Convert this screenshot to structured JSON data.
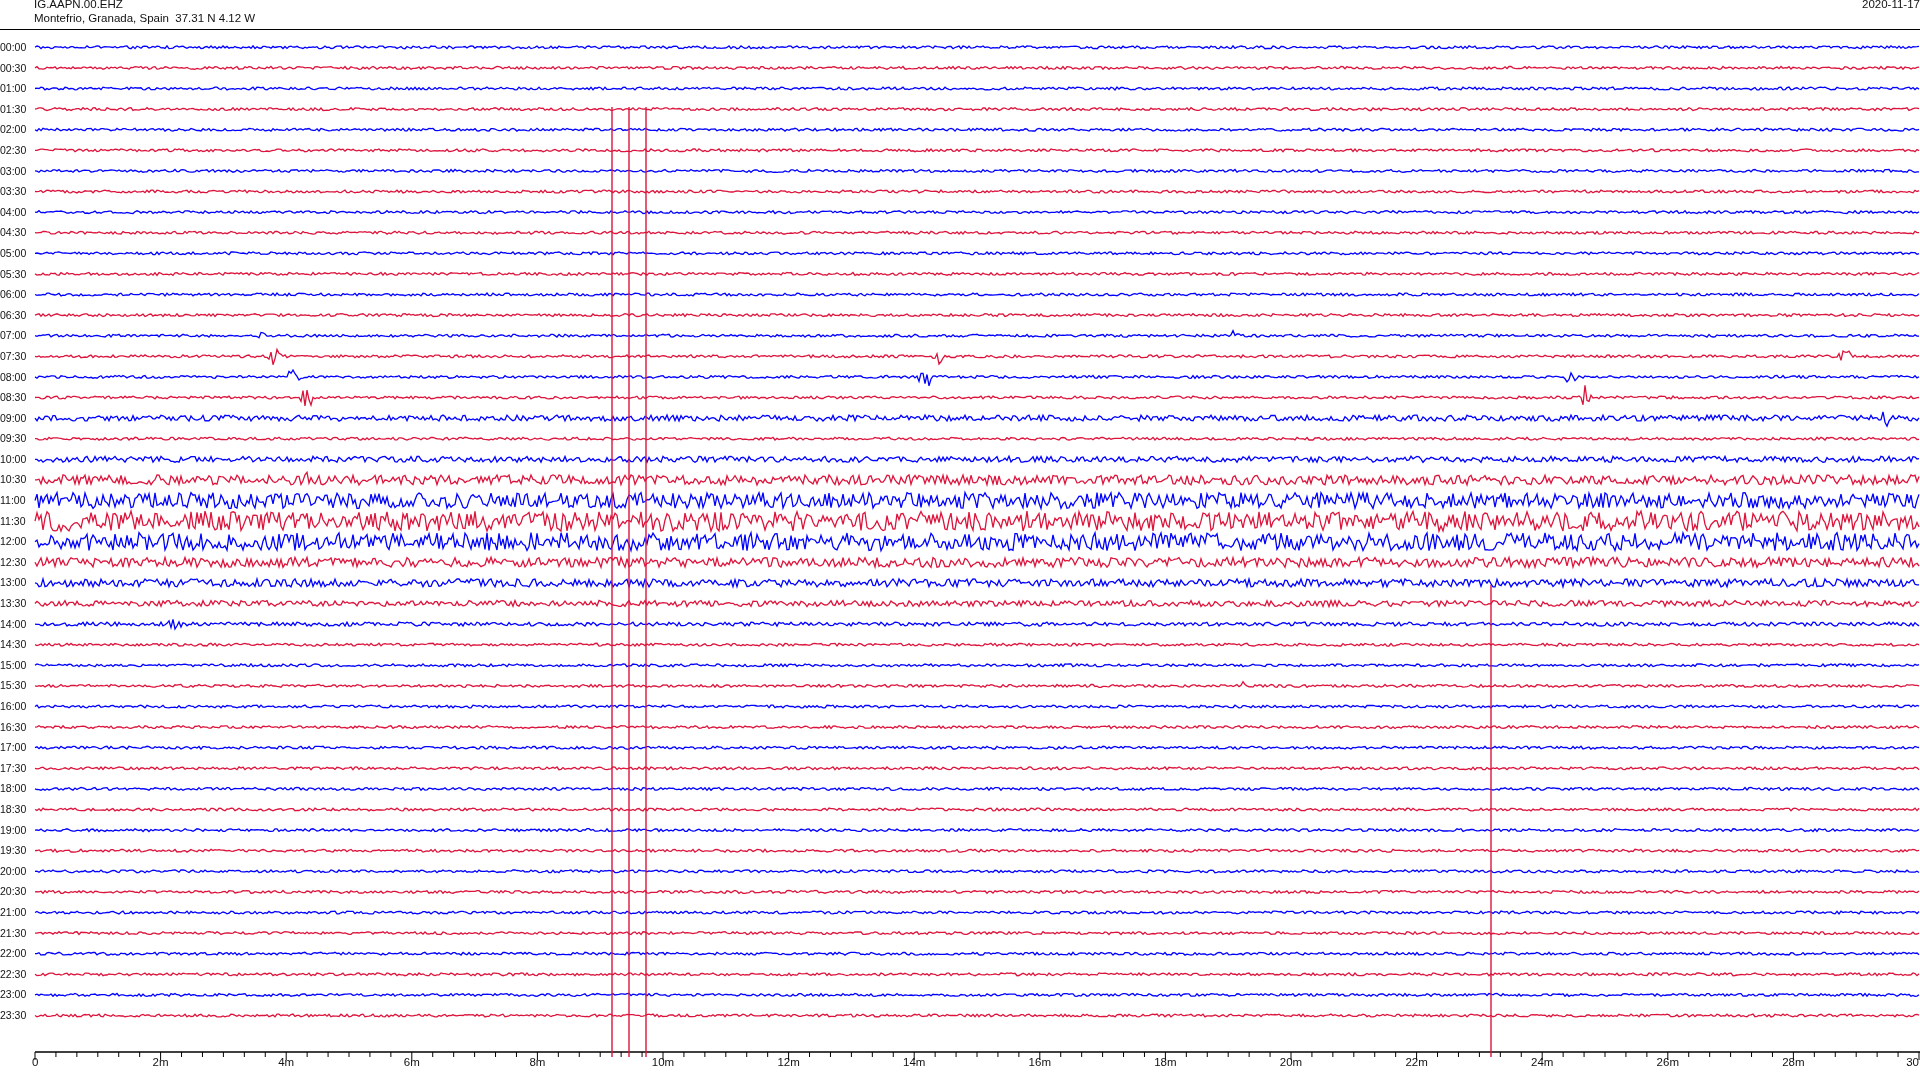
{
  "header": {
    "station": "IG.AAPN.00.EHZ",
    "location": "Montefrio, Granada, Spain  37.31 N 4.12 W",
    "date": "2020-11-17"
  },
  "rows": [
    {
      "time": "00:00",
      "color": "#0000ff"
    },
    {
      "time": "00:30",
      "color": "#dc143c"
    },
    {
      "time": "01:00",
      "color": "#0000ff"
    },
    {
      "time": "01:30",
      "color": "#dc143c"
    },
    {
      "time": "02:00",
      "color": "#0000ff"
    },
    {
      "time": "02:30",
      "color": "#dc143c"
    },
    {
      "time": "03:00",
      "color": "#0000ff"
    },
    {
      "time": "03:30",
      "color": "#dc143c"
    },
    {
      "time": "04:00",
      "color": "#0000ff"
    },
    {
      "time": "04:30",
      "color": "#dc143c"
    },
    {
      "time": "05:00",
      "color": "#0000ff"
    },
    {
      "time": "05:30",
      "color": "#dc143c"
    },
    {
      "time": "06:00",
      "color": "#0000ff"
    },
    {
      "time": "06:30",
      "color": "#dc143c"
    },
    {
      "time": "07:00",
      "color": "#0000ff"
    },
    {
      "time": "07:30",
      "color": "#dc143c"
    },
    {
      "time": "08:00",
      "color": "#0000ff"
    },
    {
      "time": "08:30",
      "color": "#dc143c"
    },
    {
      "time": "09:00",
      "color": "#0000ff"
    },
    {
      "time": "09:30",
      "color": "#dc143c"
    },
    {
      "time": "10:00",
      "color": "#0000ff"
    },
    {
      "time": "10:30",
      "color": "#dc143c"
    },
    {
      "time": "11:00",
      "color": "#0000ff"
    },
    {
      "time": "11:30",
      "color": "#dc143c"
    },
    {
      "time": "12:00",
      "color": "#0000ff"
    },
    {
      "time": "12:30",
      "color": "#dc143c"
    },
    {
      "time": "13:00",
      "color": "#0000ff"
    },
    {
      "time": "13:30",
      "color": "#dc143c"
    },
    {
      "time": "14:00",
      "color": "#0000ff"
    },
    {
      "time": "14:30",
      "color": "#dc143c"
    },
    {
      "time": "15:00",
      "color": "#0000ff"
    },
    {
      "time": "15:30",
      "color": "#dc143c"
    },
    {
      "time": "16:00",
      "color": "#0000ff"
    },
    {
      "time": "16:30",
      "color": "#dc143c"
    },
    {
      "time": "17:00",
      "color": "#0000ff"
    },
    {
      "time": "17:30",
      "color": "#dc143c"
    },
    {
      "time": "18:00",
      "color": "#0000ff"
    },
    {
      "time": "18:30",
      "color": "#dc143c"
    },
    {
      "time": "19:00",
      "color": "#0000ff"
    },
    {
      "time": "19:30",
      "color": "#dc143c"
    },
    {
      "time": "20:00",
      "color": "#0000ff"
    },
    {
      "time": "20:30",
      "color": "#dc143c"
    },
    {
      "time": "21:00",
      "color": "#0000ff"
    },
    {
      "time": "21:30",
      "color": "#dc143c"
    },
    {
      "time": "22:00",
      "color": "#0000ff"
    },
    {
      "time": "22:30",
      "color": "#dc143c"
    },
    {
      "time": "23:00",
      "color": "#0000ff"
    },
    {
      "time": "23:30",
      "color": "#dc143c"
    }
  ],
  "x_axis": {
    "ticks": [
      "0",
      "2m",
      "4m",
      "6m",
      "8m",
      "10m",
      "12m",
      "14m",
      "16m",
      "18m",
      "20m",
      "22m",
      "24m",
      "26m",
      "28m",
      "30"
    ]
  }
}
